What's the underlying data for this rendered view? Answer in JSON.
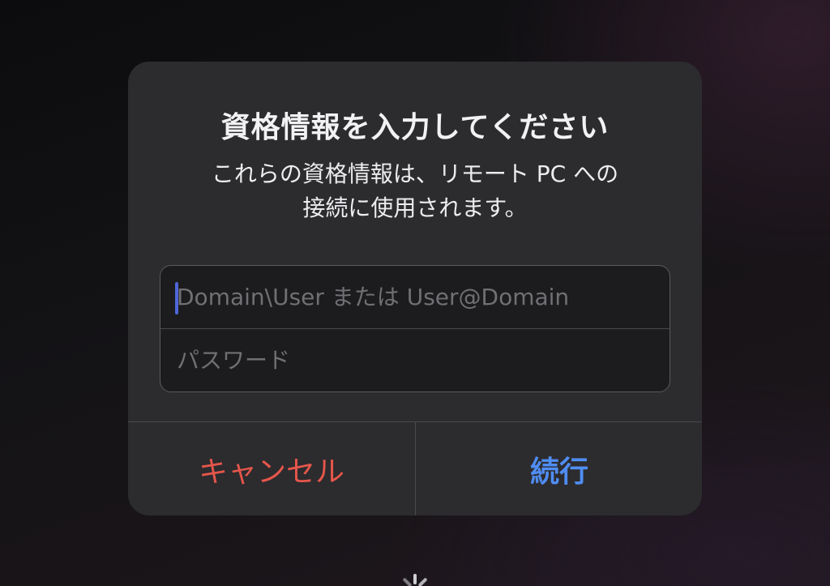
{
  "dialog": {
    "title": "資格情報を入力してください",
    "message_line1": "これらの資格情報は、リモート PC への",
    "message_line2": "接続に使用されます。",
    "username_placeholder": "Domain\\User または User@Domain",
    "username_value": "",
    "password_placeholder": "パスワード",
    "password_value": "",
    "cancel_label": "キャンセル",
    "continue_label": "続行"
  },
  "colors": {
    "cancel": "#e5564b",
    "continue": "#4f8df2",
    "caret": "#4e66d8",
    "dialog_background": "#2c2b2e"
  },
  "icons": {
    "loading": "spinner-icon"
  }
}
